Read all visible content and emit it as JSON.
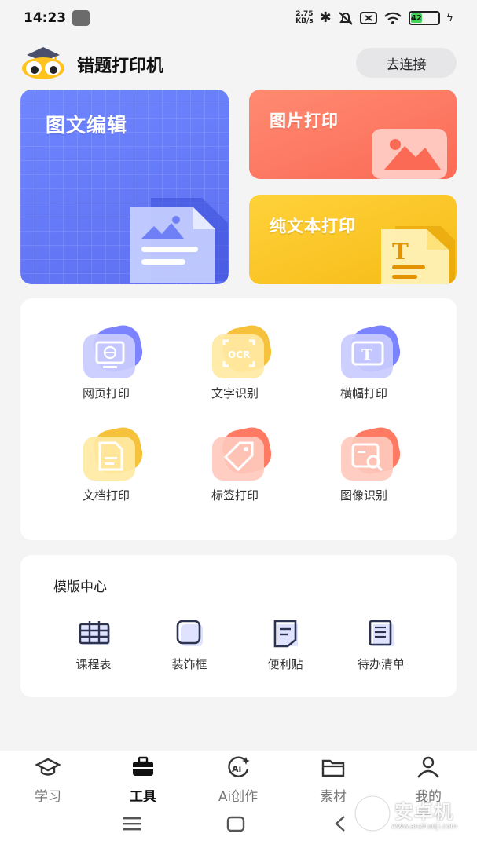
{
  "status": {
    "time": "14:23",
    "speed_value": "2.75",
    "speed_unit": "KB/s",
    "battery": "42"
  },
  "header": {
    "title": "错题打印机",
    "connect_label": "去连接"
  },
  "features": {
    "edit": "图文编辑",
    "photo": "图片打印",
    "text": "纯文本打印"
  },
  "tools": [
    {
      "label": "网页打印",
      "icon": "monitor-icon",
      "color": "#7b83ff"
    },
    {
      "label": "文字识别",
      "icon": "ocr-icon",
      "color": "#f6c23b"
    },
    {
      "label": "横幅打印",
      "icon": "banner-t-icon",
      "color": "#7b83ff"
    },
    {
      "label": "文档打印",
      "icon": "document-icon",
      "color": "#f6c23b"
    },
    {
      "label": "标签打印",
      "icon": "tag-icon",
      "color": "#ff7a63"
    },
    {
      "label": "图像识别",
      "icon": "image-search-icon",
      "color": "#ff7a63"
    }
  ],
  "templates": {
    "title": "模版中心",
    "items": [
      {
        "label": "课程表",
        "icon": "timetable-icon"
      },
      {
        "label": "装饰框",
        "icon": "frame-icon"
      },
      {
        "label": "便利贴",
        "icon": "sticky-note-icon"
      },
      {
        "label": "待办清单",
        "icon": "todo-list-icon"
      }
    ]
  },
  "nav": [
    {
      "label": "学习",
      "icon": "graduation-cap-icon",
      "active": false
    },
    {
      "label": "工具",
      "icon": "toolbox-icon",
      "active": true
    },
    {
      "label": "Ai创作",
      "icon": "ai-create-icon",
      "active": false
    },
    {
      "label": "素材",
      "icon": "folder-icon",
      "active": false
    },
    {
      "label": "我的",
      "icon": "user-icon",
      "active": false
    }
  ],
  "watermark": {
    "text": "安卓机",
    "url": "www.anzhuoji.com"
  },
  "colors": {
    "blue": "#5d6ff1",
    "coral": "#fb6a55",
    "yellow": "#f6bb16"
  }
}
